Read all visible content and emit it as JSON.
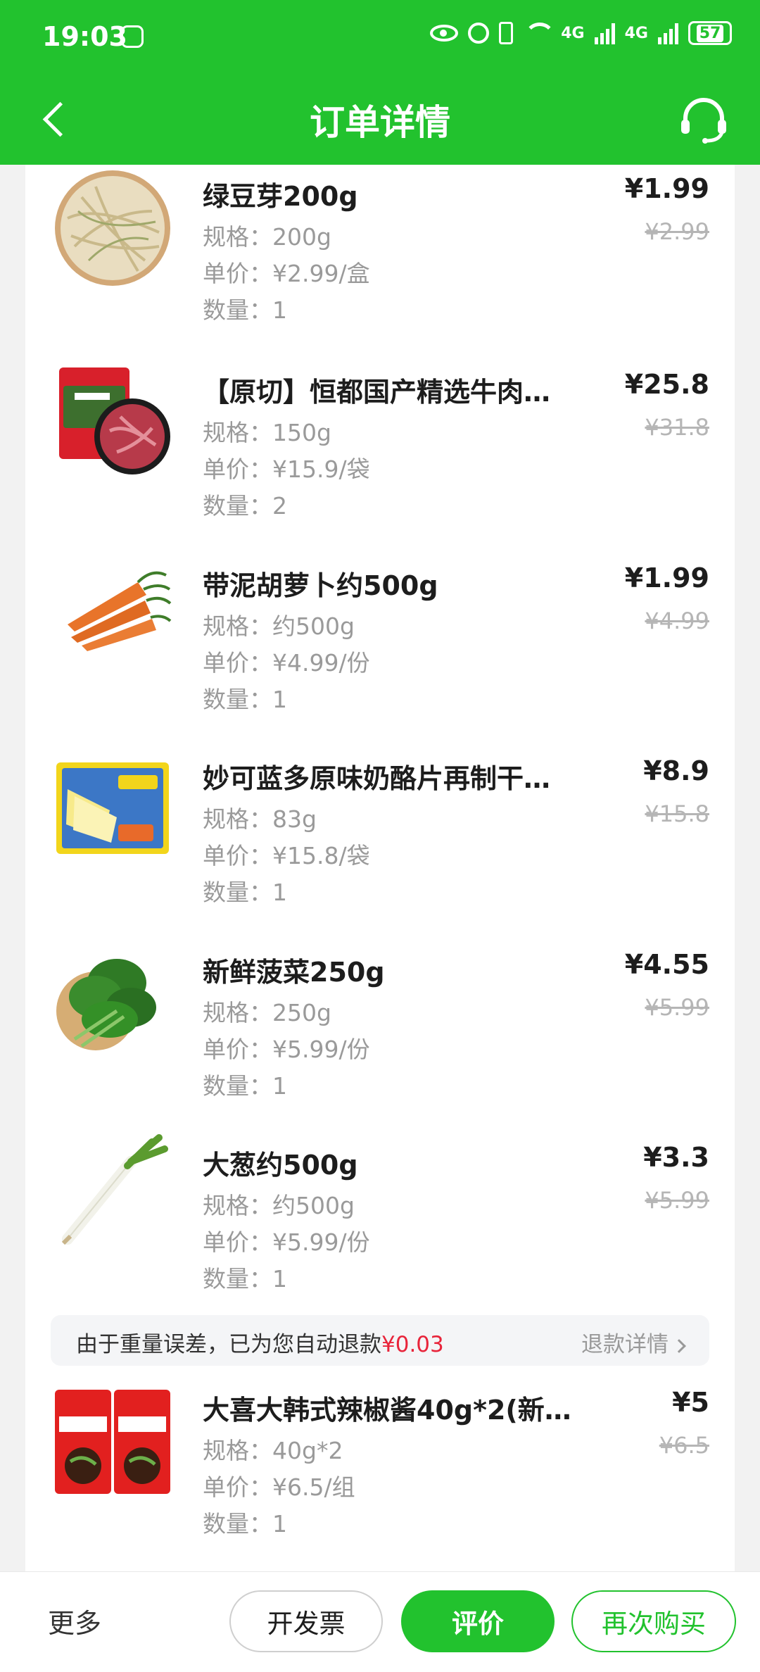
{
  "status_bar": {
    "time": "19:03",
    "network1": "4G",
    "network2": "4G",
    "battery": "57"
  },
  "nav": {
    "title": "订单详情",
    "back_icon": "chevron-left-icon",
    "support_icon": "headset-icon"
  },
  "items": [
    {
      "name": "绿豆芽200g",
      "spec": "规格：200g",
      "unit_price": "单价：¥2.99/盒",
      "quantity": "数量：1",
      "price": "¥1.99",
      "original_price": "¥2.99",
      "image": "bean-sprouts"
    },
    {
      "name": "【原切】恒都国产精选牛肉…",
      "spec": "规格：150g",
      "unit_price": "单价：¥15.9/袋",
      "quantity": "数量：2",
      "price": "¥25.8",
      "original_price": "¥31.8",
      "image": "beef-pack"
    },
    {
      "name": "带泥胡萝卜约500g",
      "spec": "规格：约500g",
      "unit_price": "单价：¥4.99/份",
      "quantity": "数量：1",
      "price": "¥1.99",
      "original_price": "¥4.99",
      "image": "carrots"
    },
    {
      "name": "妙可蓝多原味奶酪片再制干…",
      "spec": "规格：83g",
      "unit_price": "单价：¥15.8/袋",
      "quantity": "数量：1",
      "price": "¥8.9",
      "original_price": "¥15.8",
      "image": "cheese-slices"
    },
    {
      "name": "新鲜菠菜250g",
      "spec": "规格：250g",
      "unit_price": "单价：¥5.99/份",
      "quantity": "数量：1",
      "price": "¥4.55",
      "original_price": "¥5.99",
      "image": "spinach"
    },
    {
      "name": "大葱约500g",
      "spec": "规格：约500g",
      "unit_price": "单价：¥5.99/份",
      "quantity": "数量：1",
      "price": "¥3.3",
      "original_price": "¥5.99",
      "image": "scallion"
    },
    {
      "name": "大喜大韩式辣椒酱40g*2(新…",
      "spec": "规格：40g*2",
      "unit_price": "单价：¥6.5/组",
      "quantity": "数量：1",
      "price": "¥5",
      "original_price": "¥6.5",
      "image": "chili-sauce"
    }
  ],
  "refund_notice": {
    "text": "由于重量误差，已为您自动退款",
    "amount": "¥0.03",
    "link": "退款详情"
  },
  "bottom_bar": {
    "more": "更多",
    "invoice": "开发票",
    "review": "评价",
    "rebuy": "再次购买"
  },
  "colors": {
    "brand_green": "#22c22e",
    "refund_red": "#e8243a"
  }
}
